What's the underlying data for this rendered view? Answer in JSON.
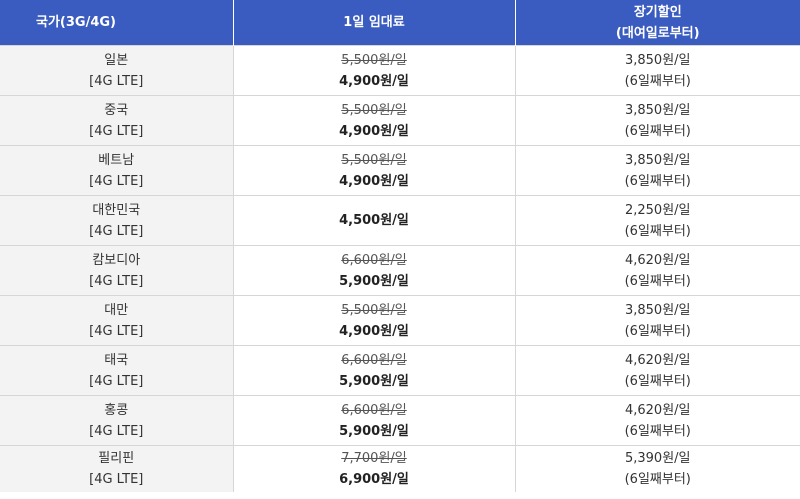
{
  "header": {
    "col_country": "국가(3G/4G)",
    "col_daily": "1일 임대료",
    "col_longterm_line1": "장기할인",
    "col_longterm_line2": "(대여일로부터)"
  },
  "rows": [
    {
      "country": "일본",
      "network": "[4G LTE]",
      "original_price": "5,500원/일",
      "sale_price": "4,900원/일",
      "long_price": "3,850원/일",
      "long_note": "(6일째부터)"
    },
    {
      "country": "중국",
      "network": "[4G LTE]",
      "original_price": "5,500원/일",
      "sale_price": "4,900원/일",
      "long_price": "3,850원/일",
      "long_note": "(6일째부터)"
    },
    {
      "country": "베트남",
      "network": "[4G LTE]",
      "original_price": "5,500원/일",
      "sale_price": "4,900원/일",
      "long_price": "3,850원/일",
      "long_note": "(6일째부터)"
    },
    {
      "country": "대한민국",
      "network": "[4G LTE]",
      "original_price": "",
      "sale_price": "4,500원/일",
      "long_price": "2,250원/일",
      "long_note": "(6일째부터)"
    },
    {
      "country": "캄보디아",
      "network": "[4G LTE]",
      "original_price": "6,600원/일",
      "sale_price": "5,900원/일",
      "long_price": "4,620원/일",
      "long_note": "(6일째부터)"
    },
    {
      "country": "대만",
      "network": "[4G LTE]",
      "original_price": "5,500원/일",
      "sale_price": "4,900원/일",
      "long_price": "3,850원/일",
      "long_note": "(6일째부터)"
    },
    {
      "country": "태국",
      "network": "[4G LTE]",
      "original_price": "6,600원/일",
      "sale_price": "5,900원/일",
      "long_price": "4,620원/일",
      "long_note": "(6일째부터)"
    },
    {
      "country": "홍콩",
      "network": "[4G LTE]",
      "original_price": "6,600원/일",
      "sale_price": "5,900원/일",
      "long_price": "4,620원/일",
      "long_note": "(6일째부터)"
    },
    {
      "country": "필리핀",
      "network": "[4G LTE]",
      "original_price": "7,700원/일",
      "sale_price": "6,900원/일",
      "long_price": "5,390원/일",
      "long_note": "(6일째부터)"
    }
  ],
  "colors": {
    "header_bg": "#3a5bbf",
    "country_cell_bg": "#f3f3f3",
    "border": "#d6d6d6"
  }
}
